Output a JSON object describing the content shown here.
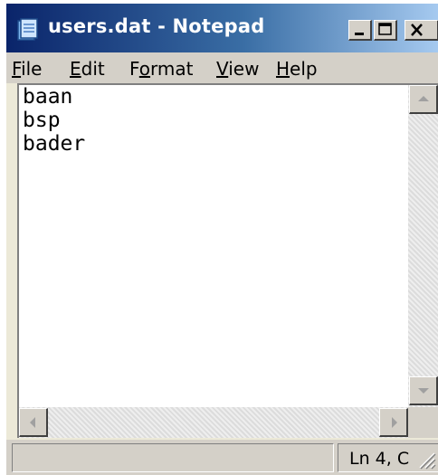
{
  "window": {
    "title": "users.dat - Notepad"
  },
  "menu": {
    "file": {
      "mnemonic": "F",
      "rest": "ile"
    },
    "edit": {
      "mnemonic": "E",
      "rest": "dit"
    },
    "format": {
      "prefix": "F",
      "mnemonic": "o",
      "rest": "rmat"
    },
    "view": {
      "mnemonic": "V",
      "rest": "iew"
    },
    "help": {
      "mnemonic": "H",
      "rest": "elp"
    }
  },
  "editor": {
    "lines": [
      "baan",
      "bsp",
      "bader"
    ]
  },
  "statusbar": {
    "left_text": "",
    "position_text": "Ln 4, C"
  },
  "icons": {
    "app": "notepad-icon",
    "minimize": "minimize-icon",
    "maximize": "maximize-icon",
    "close": "close-icon",
    "up": "arrow-up-icon",
    "down": "arrow-down-icon",
    "left": "arrow-left-icon",
    "right": "arrow-right-icon",
    "grip": "resize-grip-icon"
  },
  "colors": {
    "titlebar_start": "#0a246a",
    "titlebar_end": "#a6caf0",
    "face": "#d4d0c8"
  }
}
